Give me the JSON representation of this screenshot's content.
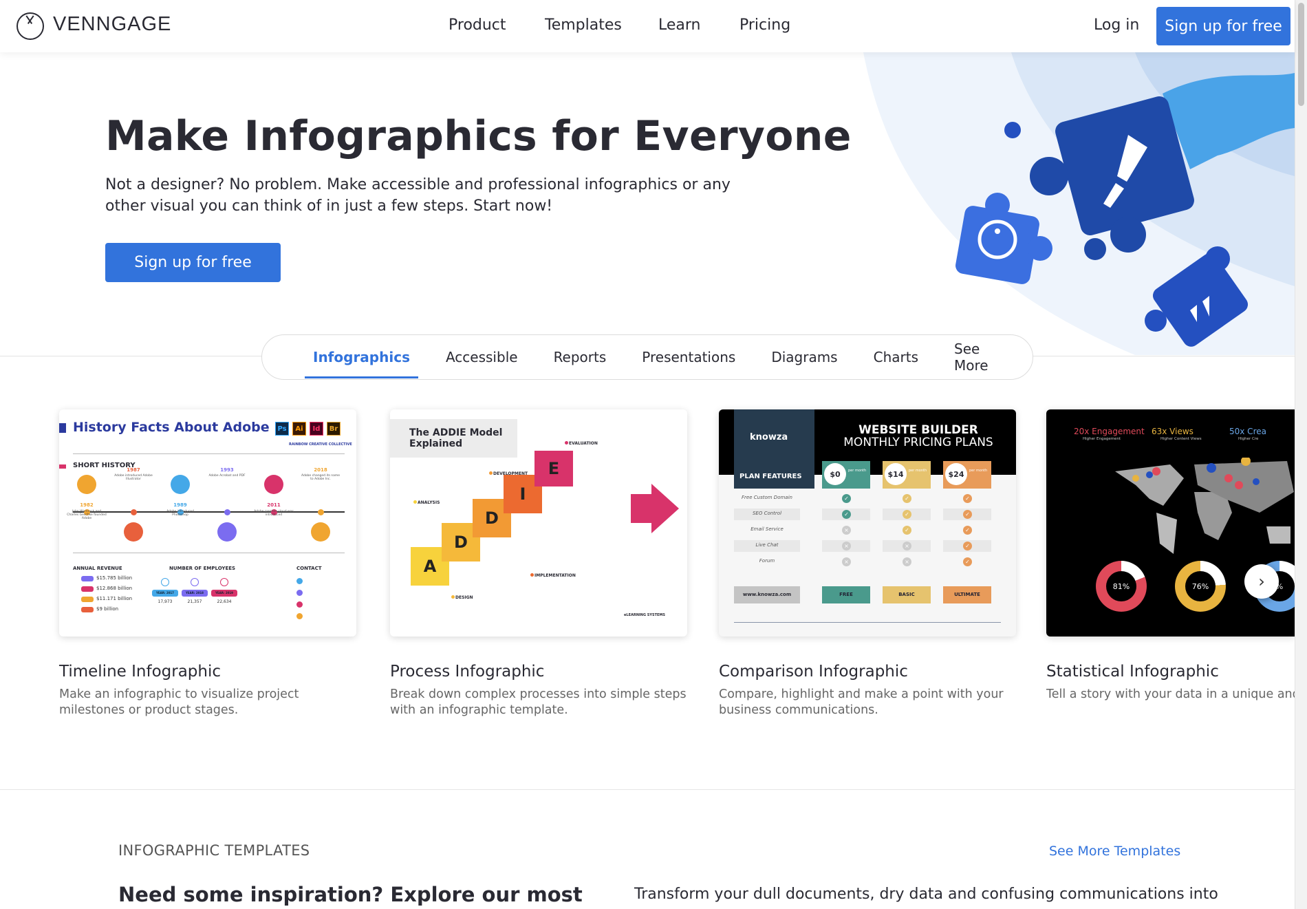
{
  "nav": {
    "brand": "VENNGAGE",
    "links": [
      "Product",
      "Templates",
      "Learn",
      "Pricing"
    ],
    "login": "Log in",
    "signup": "Sign up for free"
  },
  "hero": {
    "title": "Make Infographics for Everyone",
    "subtitle": "Not a designer? No problem. Make accessible and professional infographics or any other visual you can think of in just a few steps. Start now!",
    "cta": "Sign up for free"
  },
  "tabs": {
    "active": 0,
    "items": [
      "Infographics",
      "Accessible",
      "Reports",
      "Presentations",
      "Diagrams",
      "Charts",
      "See More"
    ]
  },
  "cards": [
    {
      "title": "Timeline Infographic",
      "desc": "Make an infographic to visualize project milestones or product stages.",
      "thumb": {
        "heading": "History Facts About Adobe",
        "apps": [
          "Ps",
          "Ai",
          "Id",
          "Br"
        ],
        "brand": "RAINBOW CREATIVE COLLECTIVE",
        "section": "SHORT HISTORY",
        "top_events": [
          {
            "year": "1987",
            "text": "Adobe introduced Adobe Illustrator"
          },
          {
            "year": "1993",
            "text": "Adobe Acrobat and PDF"
          },
          {
            "year": "2018",
            "text": "Adobe changed its name to Adobe Inc."
          }
        ],
        "bottom_events": [
          {
            "year": "1982",
            "text": "John Warnrock and Charles Geschke founded Adobe"
          },
          {
            "year": "1989",
            "text": "Adobe introduced Photoshop"
          },
          {
            "year": "2011",
            "text": "Adobe creative cloud was introduced"
          }
        ],
        "revenue_label": "ANNUAL REVENUE",
        "revenue": [
          "$15.785 billion",
          "$12.868 billion",
          "$11.171 billion",
          "$9 billion"
        ],
        "employees_label": "NUMBER OF EMPLOYEES",
        "employees": [
          {
            "year": "YEAR: 2017",
            "value": "17,973"
          },
          {
            "year": "YEAR: 2018",
            "value": "21,357"
          },
          {
            "year": "YEAR: 2019",
            "value": "22,634"
          }
        ],
        "contact_label": "CONTACT"
      }
    },
    {
      "title": "Process Infographic",
      "desc": "Break down complex processes into simple steps with an infographic template.",
      "thumb": {
        "heading": "The ADDIE Model Explained",
        "letters": [
          "A",
          "D",
          "D",
          "I",
          "E"
        ],
        "steps": [
          "ANALYSIS",
          "DESIGN",
          "DEVELOPMENT",
          "IMPLEMENTATION",
          "EVALUATION"
        ],
        "brand": "eLEARNING SYSTEMS"
      }
    },
    {
      "title": "Comparison Infographic",
      "desc": "Compare, highlight and make a point with your business communications.",
      "thumb": {
        "brand": "knowza",
        "heading1": "WEBSITE BUILDER",
        "heading2": "MONTHLY PRICING PLANS",
        "features_label": "PLAN FEATURES",
        "per": "per month",
        "prices": [
          "$0",
          "$14",
          "$24"
        ],
        "features": [
          "Free Custom Domain",
          "SEO Control",
          "Email Service",
          "Live Chat",
          "Forum"
        ],
        "matrix": [
          [
            1,
            1,
            1
          ],
          [
            1,
            1,
            1
          ],
          [
            0,
            1,
            1
          ],
          [
            0,
            0,
            1
          ],
          [
            0,
            0,
            1
          ]
        ],
        "url": "www.knowza.com",
        "plans": [
          "FREE",
          "BASIC",
          "ULTIMATE"
        ],
        "colors": [
          "#4a9a8c",
          "#e6c36e",
          "#e89b5a"
        ]
      }
    },
    {
      "title": "Statistical Infographic",
      "desc": "Tell a story with your data in a unique and captivating way.",
      "thumb": {
        "stats": [
          {
            "value": "20x Engagement",
            "label": "Higher Engagement",
            "color": "#e04a5a"
          },
          {
            "value": "63x Views",
            "label": "Higher Content Views",
            "color": "#e8b440"
          },
          {
            "value": "50x Crea",
            "label": "Higher Cre",
            "color": "#6aa6e6"
          }
        ],
        "donuts": [
          {
            "percent": 81,
            "label": "81%",
            "color": "#e04a5a"
          },
          {
            "percent": 76,
            "label": "76%",
            "color": "#e8b440"
          },
          {
            "percent": 75,
            "label": "%",
            "color": "#6aa6e6"
          }
        ]
      }
    }
  ],
  "templates": {
    "eyebrow": "INFOGRAPHIC TEMPLATES",
    "see_more": "See More Templates",
    "heading": "Need some inspiration? Explore our most",
    "text": "Transform your dull documents, dry data and confusing communications into"
  },
  "colors": {
    "accent": "#3273dc",
    "text": "#2a2a33"
  }
}
